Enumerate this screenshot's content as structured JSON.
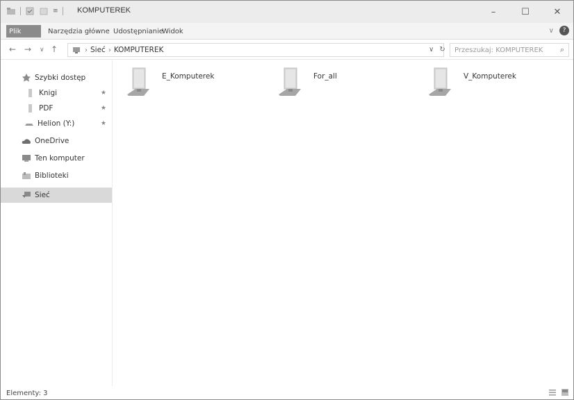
{
  "titlebar": {
    "title": "KOMPUTEREK",
    "minimize_glyph": "–",
    "maximize_glyph": "☐",
    "close_glyph": "✕",
    "qat_dropdown": "≡"
  },
  "ribbon": {
    "tabs": [
      "Plik",
      "Narzędzia główne",
      "Udostępnianie",
      "Widok"
    ],
    "expand_glyph": "∨",
    "help_glyph": "?"
  },
  "nav": {
    "back_glyph": "←",
    "forward_glyph": "→",
    "recent_glyph": "∨",
    "up_glyph": "↑",
    "breadcrumb": [
      "Sieć",
      "KOMPUTEREK"
    ],
    "crumb_separator": "›",
    "dropdown_glyph": "∨",
    "refresh_glyph": "↻",
    "search_placeholder": "Przeszukaj: KOMPUTEREK",
    "search_glyph": "⌕"
  },
  "sidebar": {
    "items": [
      {
        "label": "Szybki dostęp",
        "icon": "star-icon",
        "pinned": false
      },
      {
        "label": "Knigi",
        "icon": "folder-icon",
        "pinned": true
      },
      {
        "label": "PDF",
        "icon": "folder-icon",
        "pinned": true
      },
      {
        "label": "Helion (Y:)",
        "icon": "network-drive-icon",
        "pinned": true
      },
      {
        "label": "OneDrive",
        "icon": "cloud-icon",
        "pinned": false
      },
      {
        "label": "Ten komputer",
        "icon": "computer-icon",
        "pinned": false
      },
      {
        "label": "Biblioteki",
        "icon": "library-icon",
        "pinned": false
      },
      {
        "label": "Sieć",
        "icon": "network-icon",
        "pinned": false,
        "selected": true
      }
    ],
    "pin_glyph": "★"
  },
  "content": {
    "items": [
      {
        "label": "E_Komputerek",
        "icon": "shared-folder-icon"
      },
      {
        "label": "For_all",
        "icon": "shared-folder-icon"
      },
      {
        "label": "V_Komputerek",
        "icon": "shared-folder-icon"
      }
    ]
  },
  "status": {
    "count_text": "Elementy: 3"
  }
}
